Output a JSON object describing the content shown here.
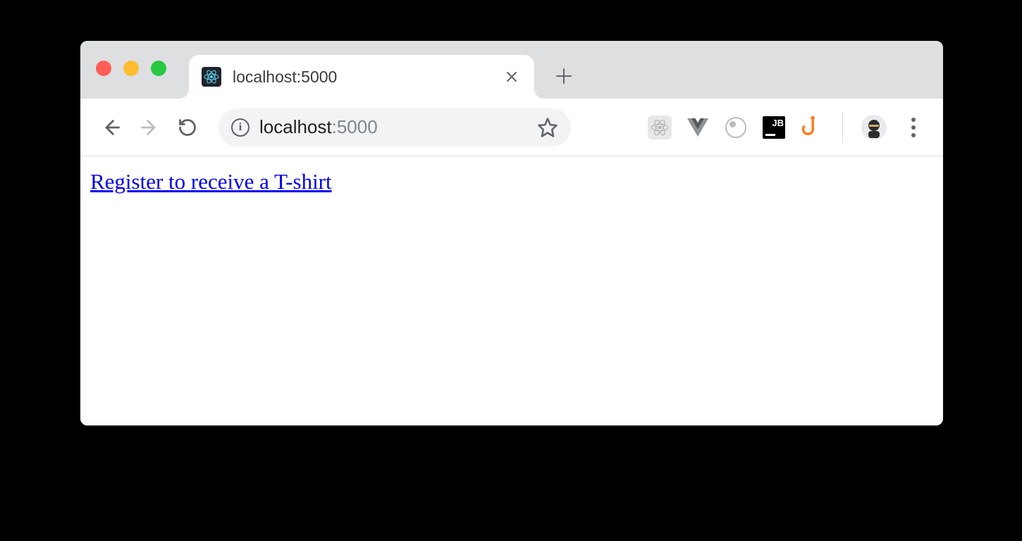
{
  "tab": {
    "title": "localhost:5000"
  },
  "address": {
    "host": "localhost",
    "port": ":5000"
  },
  "extensions": {
    "jb_label": "JB"
  },
  "page": {
    "link_text": "Register to receive a T-shirt"
  }
}
